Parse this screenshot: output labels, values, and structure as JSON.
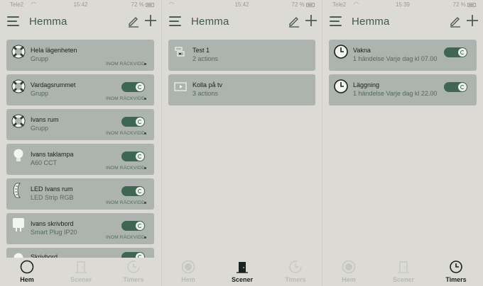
{
  "colors": {
    "background": "#dcdad5",
    "card": "#adb3ae",
    "toggle_on": "#3f6553",
    "title": "#3e5a4e"
  },
  "screens": [
    {
      "status": {
        "carrier": "Tele2",
        "time": "15:42",
        "battery": "72 %"
      },
      "title": "Hemma",
      "items": [
        {
          "name": "Hela lägenheten",
          "sub": "Grupp",
          "range": "INOM RÄCKVIDD",
          "icon": "lifebuoy-icon",
          "toggle": false
        },
        {
          "name": "Vardagsrummet",
          "sub": "Grupp",
          "range": "INOM RÄCKVIDD",
          "icon": "lifebuoy-icon",
          "toggle": true
        },
        {
          "name": "Ivans rum",
          "sub": "Grupp",
          "range": "INOM RÄCKVIDD",
          "icon": "lifebuoy-icon",
          "toggle": true
        },
        {
          "name": "Ivans taklampa",
          "sub": "A60 CCT",
          "range": "INOM RÄCKVIDD",
          "icon": "bulb-icon",
          "toggle": true
        },
        {
          "name": "LED Ivans rum",
          "sub": "LED Strip RGB",
          "range": "INOM RÄCKVIDD",
          "icon": "led-strip-icon",
          "toggle": true
        },
        {
          "name": "Ivans skrivbord",
          "sub": "Smart Plug IP20",
          "range": "INOM RÄCKVIDD",
          "icon": "plug-icon",
          "toggle": true
        },
        {
          "name": "Skrivbord",
          "sub": "",
          "range": "",
          "icon": "bulb-icon",
          "toggle": true
        }
      ],
      "active_tab": 0
    },
    {
      "status": {
        "carrier": "",
        "time": "15:42",
        "battery": "72 %"
      },
      "title": "Hemma",
      "items": [
        {
          "name": "Test 1",
          "sub": "2 actions",
          "icon": "scene-device-icon"
        },
        {
          "name": "Kolla på tv",
          "sub": "3 actions",
          "icon": "tv-icon"
        }
      ],
      "active_tab": 1
    },
    {
      "status": {
        "carrier": "Tele2",
        "time": "15:39",
        "battery": "72 %"
      },
      "title": "Hemma",
      "items": [
        {
          "name": "Vakna",
          "sub": "1 händelse Varje dag kl 07.00",
          "icon": "clock-icon",
          "toggle": true
        },
        {
          "name": "Läggning",
          "sub": "1 händelse Varje dag kl 22.00",
          "icon": "clock-icon",
          "toggle": true
        }
      ],
      "active_tab": 2
    }
  ],
  "tabs": [
    {
      "label": "Hem",
      "icon": "home-circle-icon"
    },
    {
      "label": "Scener",
      "icon": "door-icon"
    },
    {
      "label": "Timers",
      "icon": "timer-icon"
    }
  ]
}
